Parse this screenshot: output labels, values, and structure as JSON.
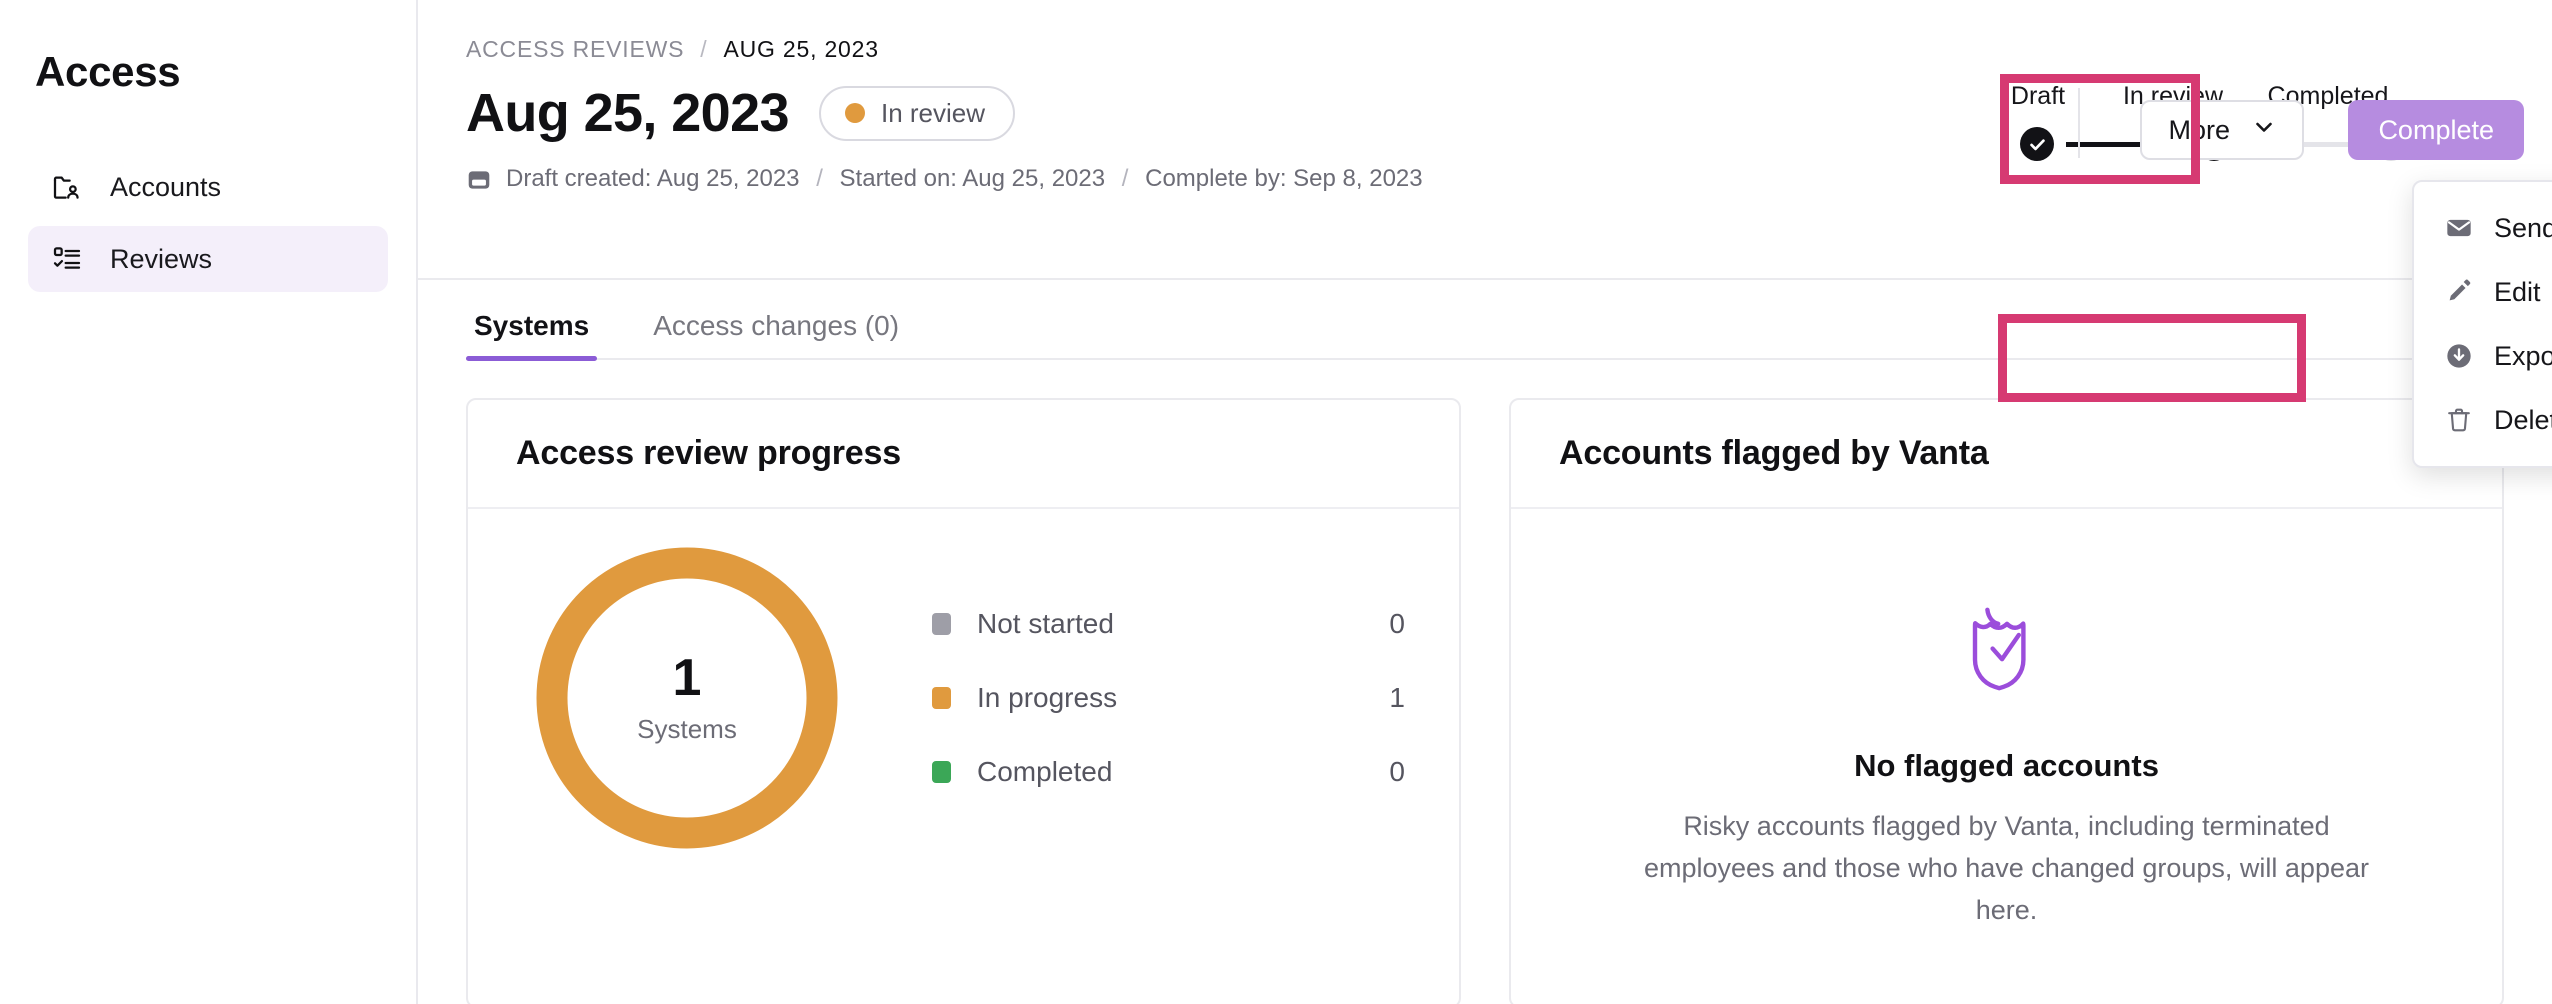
{
  "sidebar": {
    "title": "Access",
    "items": [
      {
        "label": "Accounts",
        "icon": "folder-user-icon",
        "active": false
      },
      {
        "label": "Reviews",
        "icon": "checklist-icon",
        "active": true
      }
    ]
  },
  "header": {
    "breadcrumb": {
      "root": "ACCESS REVIEWS",
      "separator": "/",
      "current": "AUG 25, 2023"
    },
    "title": "Aug 25, 2023",
    "status": {
      "label": "In review",
      "dot_color": "#e09a3e"
    },
    "meta": {
      "icon": "calendar-icon",
      "draft_created": "Draft created: Aug 25, 2023",
      "separator": "/",
      "started_on": "Started on: Aug 25, 2023",
      "complete_by": "Complete by: Sep 8, 2023"
    },
    "stepper": {
      "steps": [
        {
          "label": "Draft",
          "state": "done"
        },
        {
          "label": "In review",
          "state": "current"
        },
        {
          "label": "Completed",
          "state": "upcoming"
        }
      ]
    },
    "actions": {
      "more_label": "More",
      "more_icon": "chevron-down-icon",
      "complete_label": "Complete",
      "complete_color": "#b68ce0"
    }
  },
  "dropdown": {
    "open": true,
    "items": [
      {
        "label": "Send reminders",
        "icon": "envelope-icon"
      },
      {
        "label": "Edit",
        "icon": "pencil-icon"
      },
      {
        "label": "Export",
        "icon": "download-circle-icon"
      },
      {
        "label": "Delete",
        "icon": "trash-icon"
      }
    ]
  },
  "annotations": {
    "color": "#d63a72",
    "boxes": [
      {
        "target": "more-button"
      },
      {
        "target": "export-menu-item"
      }
    ]
  },
  "tabs": [
    {
      "label": "Systems",
      "active": true
    },
    {
      "label": "Access changes (0)",
      "active": false
    }
  ],
  "progress_card": {
    "title": "Access review progress",
    "donut": {
      "number": "1",
      "caption": "Systems"
    }
  },
  "flagged_card": {
    "title": "Accounts flagged by Vanta",
    "icon": "shield-check-icon",
    "icon_color": "#9b4ddb",
    "empty_title": "No flagged accounts",
    "empty_desc": "Risky accounts flagged by Vanta, including terminated employees and those who have changed groups, will appear here."
  },
  "chart_data": {
    "type": "pie",
    "title": "Access review progress",
    "center_value": "1",
    "center_label": "Systems",
    "categories": [
      "Not started",
      "In progress",
      "Completed"
    ],
    "values": [
      0,
      1,
      0
    ],
    "colors": [
      "#9e9ea7",
      "#e09a3e",
      "#3ba757"
    ],
    "total": 1,
    "legend_position": "right",
    "labels": [
      "0",
      "1",
      "0"
    ]
  }
}
